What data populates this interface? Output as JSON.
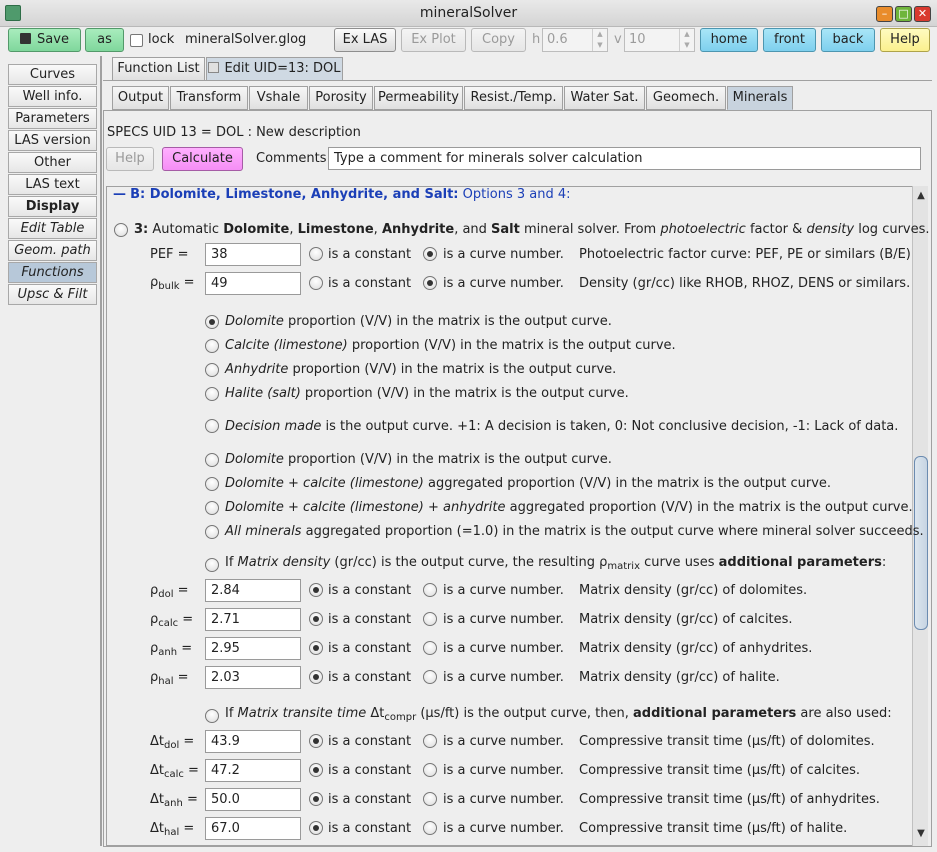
{
  "window": {
    "title": "mineralSolver"
  },
  "toolbar": {
    "save_label": "Save",
    "as_label": "as",
    "lock_label": "lock",
    "filename": "mineralSolver.glog",
    "ex_las_label": "Ex LAS",
    "ex_plot_label": "Ex Plot",
    "copy_label": "Copy",
    "h_label": "h",
    "h_value": "0.6",
    "v_label": "v",
    "v_value": "10",
    "home_label": "home",
    "front_label": "front",
    "back_label": "back",
    "help_label": "Help"
  },
  "sidebar": {
    "items": [
      {
        "label": "Curves"
      },
      {
        "label": "Well info."
      },
      {
        "label": "Parameters"
      },
      {
        "label": "LAS version"
      },
      {
        "label": "Other"
      },
      {
        "label": "LAS text"
      },
      {
        "label": "Display"
      },
      {
        "label": "Edit Table"
      },
      {
        "label": "Geom. path"
      },
      {
        "label": "Functions"
      },
      {
        "label": "Upsc & Filt"
      }
    ]
  },
  "top_tabs": [
    {
      "label": "Function List"
    },
    {
      "label": "Edit UID=13: DOL"
    }
  ],
  "sub_tabs": [
    {
      "label": "Output"
    },
    {
      "label": "Transform"
    },
    {
      "label": "Vshale"
    },
    {
      "label": "Porosity"
    },
    {
      "label": "Permeability"
    },
    {
      "label": "Resist./Temp."
    },
    {
      "label": "Water Sat."
    },
    {
      "label": "Geomech."
    },
    {
      "label": "Minerals"
    }
  ],
  "specs": {
    "text": "SPECS UID 13 = DOL : New description",
    "help_label": "Help",
    "calculate_label": "Calculate",
    "comments_label": "Comments:",
    "comments_value": "Type a comment for minerals solver calculation"
  },
  "section": {
    "dash": "—",
    "title_bold": "B: Dolomite, Limestone, Anhydrite, and Salt:",
    "title_rest": " Options 3 and 4:"
  },
  "option3": {
    "num": "3:",
    "t1": " Automatic ",
    "dol": "Dolomite",
    "c1": ", ",
    "lim": "Limestone",
    "c2": ", ",
    "anh": "Anhydrite",
    "c3": ", and ",
    "salt": "Salt",
    "t2": " mineral solver. From ",
    "pef_it": "photoelectric",
    "t3": " factor & ",
    "den_it": "density",
    "t4": " log curves."
  },
  "labels": {
    "is_constant": "is a constant",
    "is_curve": "is a curve number."
  },
  "inputs": [
    {
      "sym": "PEF =",
      "sub": "",
      "value": "38",
      "constant": false,
      "desc": "Photoelectric factor curve: PEF, PE or similars (B/E)"
    },
    {
      "sym": "ρ",
      "sub": "bulk",
      "eq": " =",
      "value": "49",
      "constant": false,
      "desc": "Density (gr/cc) like RHOB, RHOZ, DENS or similars."
    }
  ],
  "outputs": [
    {
      "it": "Dolomite",
      "rest": " proportion (V/V) in the matrix is the output curve.",
      "on": true
    },
    {
      "it": "Calcite (limestone)",
      "rest": " proportion (V/V) in the matrix is the output curve.",
      "on": false
    },
    {
      "it": "Anhydrite",
      "rest": " proportion (V/V) in the matrix is the output curve.",
      "on": false
    },
    {
      "it": "Halite (salt)",
      "rest": " proportion (V/V) in the matrix is the output curve.",
      "on": false
    },
    {
      "it": "Decision made",
      "rest": " is the output curve. +1: A decision is taken, 0: Not conclusive decision, -1: Lack of data.",
      "on": false
    },
    {
      "it": "Dolomite",
      "rest": " proportion (V/V) in the matrix is the output curve.",
      "on": false
    },
    {
      "it": "Dolomite + calcite (limestone)",
      "rest": " aggregated proportion (V/V) in the matrix is the output curve.",
      "on": false
    },
    {
      "it": "Dolomite + calcite (limestone) + anhydrite",
      "rest": " aggregated proportion (V/V) in the matrix is the output curve.",
      "on": false
    },
    {
      "it": "All minerals",
      "rest": " aggregated proportion (=1.0) in the matrix is the output curve where mineral solver succeeds.",
      "on": false
    }
  ],
  "matrix_density": {
    "t1": "If ",
    "it": "Matrix density",
    "t2": " (gr/cc) is the output curve, the resulting ",
    "rho": "ρ",
    "sub": "matrix",
    "t3": " curve uses ",
    "bold": "additional parameters",
    "t4": ":"
  },
  "density_params": [
    {
      "sym": "ρ",
      "sub": "dol",
      "eq": " =",
      "value": "2.84",
      "desc": "Matrix density (gr/cc) of dolomites."
    },
    {
      "sym": "ρ",
      "sub": "calc",
      "eq": " =",
      "value": "2.71",
      "desc": "Matrix density (gr/cc) of calcites."
    },
    {
      "sym": "ρ",
      "sub": "anh",
      "eq": " =",
      "value": "2.95",
      "desc": "Matrix density (gr/cc) of anhydrites."
    },
    {
      "sym": "ρ",
      "sub": "hal",
      "eq": " =",
      "value": "2.03",
      "desc": "Matrix density (gr/cc) of halite."
    }
  ],
  "transit_time": {
    "t1": "If ",
    "it": "Matrix transite time",
    "t2": " Δt",
    "sub": "compr",
    "t3": " (μs/ft) is the output curve, then, ",
    "bold": "additional parameters",
    "t4": " are also used:"
  },
  "transit_params": [
    {
      "sym": "Δt",
      "sub": "dol",
      "eq": " =",
      "value": "43.9",
      "desc": "Compressive transit time (μs/ft) of dolomites."
    },
    {
      "sym": "Δt",
      "sub": "calc",
      "eq": " =",
      "value": "47.2",
      "desc": "Compressive transit time (μs/ft) of calcites."
    },
    {
      "sym": "Δt",
      "sub": "anh",
      "eq": " =",
      "value": "50.0",
      "desc": "Compressive transit time (μs/ft) of anhydrites."
    },
    {
      "sym": "Δt",
      "sub": "hal",
      "eq": " =",
      "value": "67.0",
      "desc": "Compressive transit time (μs/ft) of halite."
    }
  ]
}
